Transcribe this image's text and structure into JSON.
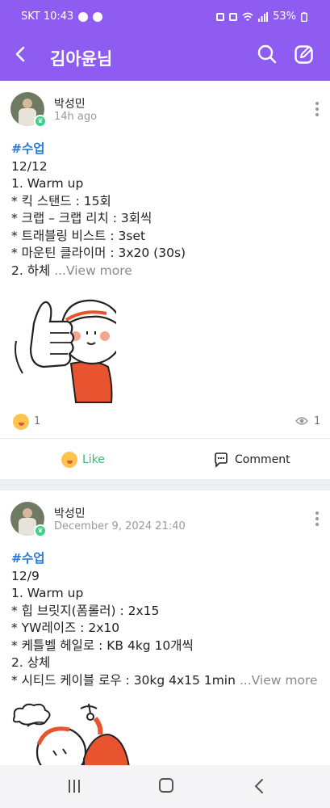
{
  "status_bar": {
    "carrier_time": "SKT 10:43",
    "battery": "53%"
  },
  "header": {
    "title": "김아윤님",
    "back_icon": "chevron-left-icon",
    "search_icon": "search-icon",
    "edit_icon": "edit-icon",
    "background_color": "#8e5cf0"
  },
  "posts": [
    {
      "author": "박성민",
      "time": "14h ago",
      "tag": "#수업",
      "lines": [
        "12/12",
        "1. Warm up",
        "* 킥 스탠드 : 15회",
        "* 크랩 – 크랩 리치 : 3회씩",
        "* 트래블링 비스트 : 3set",
        "* 마운틴 클라이머 : 3x20 (30s)",
        "2. 하체"
      ],
      "more_label": "...View more",
      "sticker": "thumbs-up-sticker",
      "reaction_count": "1",
      "view_count": "1",
      "like_label": "Like",
      "comment_label": "Comment"
    },
    {
      "author": "박성민",
      "time": "December 9, 2024 21:40",
      "tag": "#수업",
      "lines": [
        "12/9",
        "1. Warm up",
        "* 힙 브릿지(폼롤러) : 2x15",
        "* YW레이즈 : 2x10",
        "* 케틀벨 헤일로 : KB 4kg 10개씩",
        "2. 상체"
      ],
      "last_line": "* 시티드 케이블 로우 : 30kg 4x15 1min",
      "more_label": "...View more",
      "sticker": "exercise-sticker"
    }
  ],
  "accent_colors": {
    "tag": "#2d7ad6",
    "like": "#3fb86e",
    "badge": "#3fcf88"
  }
}
